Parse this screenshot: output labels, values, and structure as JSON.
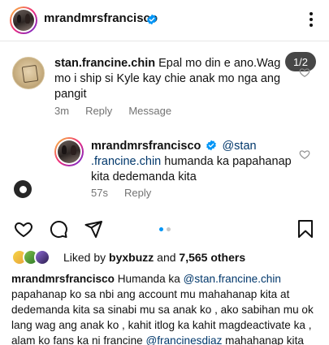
{
  "header": {
    "username": "mrandmrsfrancisco",
    "icon_verified": "verified-badge-icon",
    "icon_more": "kebab-menu-icon"
  },
  "comment": {
    "username": "stan.francine.chin",
    "text": "Epal mo din e ano.Wag mo i ship si Kyle kay chie anak mo nga ang pangit",
    "time": "3m",
    "reply_label": "Reply",
    "message_label": "Message"
  },
  "page_badge": "1/2",
  "reply": {
    "username": "mrandmrsfrancisco",
    "mention": "@stan .francine.chin",
    "text": " humanda ka papahanap kita dedemanda kita",
    "time": "57s",
    "reply_label": "Reply"
  },
  "post": {
    "liked_by_prefix": "Liked by ",
    "liked_by_user": "byxbuzz",
    "liked_and": " and ",
    "liked_count": "7,565 others",
    "caption_user": "mrandmrsfrancisco",
    "caption_text_1": " Humanda ka ",
    "caption_mention_1": "@stan.francine.chin",
    "caption_text_2": " papahanap ko sa nbi ang account mu mahahanap kita at dedemanda kita sa sinabi mu sa anak ko , ako sabihan mu ok lang wag ang anak ko , kahit itlog ka kahit magdeactivate ka , alam ko fans ka ni francine ",
    "caption_mention_2": "@francinesdiaz",
    "caption_text_3": " mahahanap kita"
  },
  "colors": {
    "verified_blue": "#0095f6",
    "mention_blue": "#00376b",
    "meta_gray": "#737373"
  }
}
